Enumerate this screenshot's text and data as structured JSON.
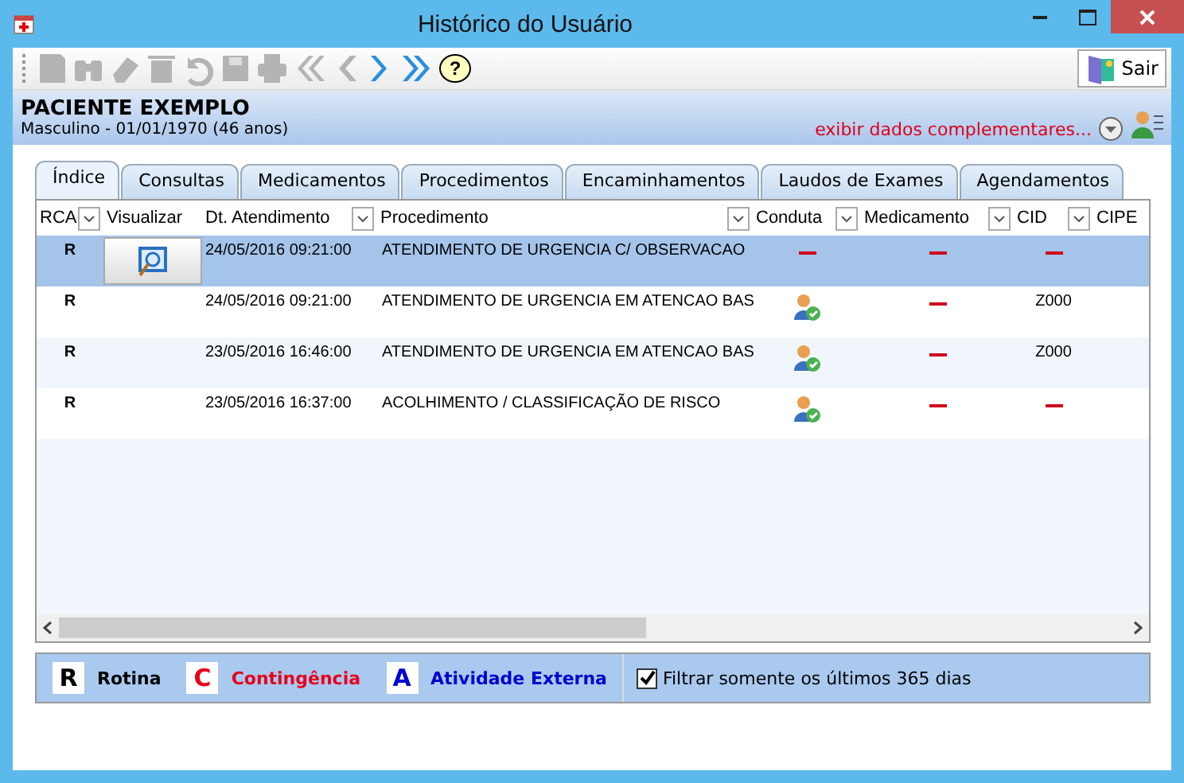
{
  "window": {
    "title": "Histórico do Usuário"
  },
  "toolbar": [
    {
      "kind": "new",
      "disabled": true
    },
    {
      "kind": "find",
      "disabled": true
    },
    {
      "kind": "erase",
      "disabled": true
    },
    {
      "kind": "delete",
      "disabled": true
    },
    {
      "kind": "undo",
      "disabled": true
    },
    {
      "kind": "save",
      "disabled": true
    },
    {
      "kind": "print",
      "disabled": true
    },
    {
      "kind": "first",
      "disabled": true
    },
    {
      "kind": "prev",
      "disabled": true
    },
    {
      "kind": "next",
      "disabled": false
    },
    {
      "kind": "last",
      "disabled": false
    },
    {
      "kind": "help",
      "disabled": false,
      "label": "?"
    }
  ],
  "exit_button": {
    "label": "Sair"
  },
  "patient": {
    "name": "PACIENTE EXEMPLO",
    "details": "Masculino - 01/01/1970 (46 anos)",
    "more_link": "exibir dados complementares..."
  },
  "tabs": [
    {
      "label": "Índice",
      "selected": true
    },
    {
      "label": "Consultas",
      "selected": false
    },
    {
      "label": "Medicamentos",
      "selected": false
    },
    {
      "label": "Procedimentos",
      "selected": false
    },
    {
      "label": "Encaminhamentos",
      "selected": false
    },
    {
      "label": "Laudos de Exames",
      "selected": false
    },
    {
      "label": "Agendamentos",
      "selected": false
    }
  ],
  "table": {
    "columns": [
      {
        "label": "RCA",
        "filter": true
      },
      {
        "label": "Visualizar",
        "filter": false
      },
      {
        "label": "Dt. Atendimento",
        "filter": true
      },
      {
        "label": "Procedimento",
        "filter": true
      },
      {
        "label": "Conduta",
        "filter": true
      },
      {
        "label": "Medicamento",
        "filter": true
      },
      {
        "label": "CID",
        "filter": true
      },
      {
        "label": "CIPE",
        "filter": false
      }
    ],
    "rows": [
      {
        "selected": true,
        "rca": "R",
        "view_button": true,
        "date": "24/05/2016 09:21:00",
        "procedure": "ATENDIMENTO DE URGENCIA C/ OBSERVACAO",
        "conduta": {
          "kind": "dash"
        },
        "medicamento": {
          "kind": "dash"
        },
        "cid": {
          "kind": "dash"
        }
      },
      {
        "selected": false,
        "rca": "R",
        "view_button": false,
        "date": "24/05/2016 09:21:00",
        "procedure": "ATENDIMENTO DE URGENCIA EM ATENCAO BAS",
        "conduta": {
          "kind": "icon"
        },
        "medicamento": {
          "kind": "dash"
        },
        "cid": {
          "kind": "text",
          "text": "Z000"
        }
      },
      {
        "selected": false,
        "rca": "R",
        "view_button": false,
        "date": "23/05/2016 16:46:00",
        "procedure": "ATENDIMENTO DE URGENCIA EM ATENCAO BAS",
        "conduta": {
          "kind": "icon"
        },
        "medicamento": {
          "kind": "dash"
        },
        "cid": {
          "kind": "text",
          "text": "Z000"
        }
      },
      {
        "selected": false,
        "rca": "R",
        "view_button": false,
        "date": "23/05/2016 16:37:00",
        "procedure": "ACOLHIMENTO / CLASSIFICAÇÃO DE RISCO",
        "conduta": {
          "kind": "icon"
        },
        "medicamento": {
          "kind": "dash"
        },
        "cid": {
          "kind": "dash"
        }
      }
    ]
  },
  "legend": [
    {
      "letter": "R",
      "label": "Rotina",
      "color": "#000000"
    },
    {
      "letter": "C",
      "label": "Contingência",
      "color": "#e8001c"
    },
    {
      "letter": "A",
      "label": "Atividade Externa",
      "color": "#0000d0"
    }
  ],
  "filter_checkbox": {
    "label": "Filtrar somente os últimos 365 dias",
    "checked": true
  }
}
